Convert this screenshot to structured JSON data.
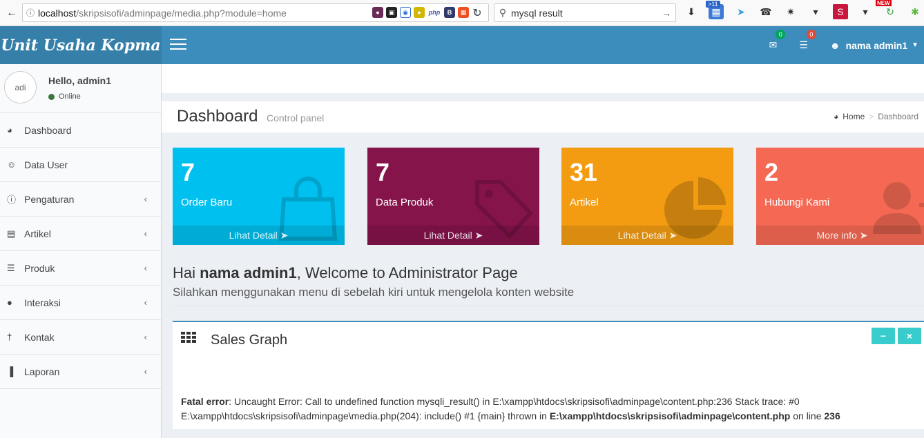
{
  "browser": {
    "back_icon": "back-arrow",
    "url_host": "localhost",
    "url_path": "/skripsisofi/adminpage/media.php?module=home",
    "search_text": "mysql result",
    "toolbar_badge": ">11",
    "new_badge": "NEW"
  },
  "header": {
    "logo": "Unit Usaha Kopma",
    "mail_count": "0",
    "notif_count": "0",
    "user_name": "nama admin1",
    "mail_badge_color": "#00a65a",
    "notif_badge_color": "#dd4b39"
  },
  "sidebar": {
    "avatar_alt": "adi",
    "hello": "Hello, admin1",
    "status": "Online",
    "items": [
      {
        "label": "Dashboard",
        "icon": "dashboard-icon",
        "glyph": "◕"
      },
      {
        "label": "Data User",
        "icon": "users-icon",
        "glyph": "☺"
      },
      {
        "label": "Pengaturan",
        "icon": "info-icon",
        "glyph": "ⓘ"
      },
      {
        "label": "Artikel",
        "icon": "book-icon",
        "glyph": "▤"
      },
      {
        "label": "Produk",
        "icon": "cart-icon",
        "glyph": "☰"
      },
      {
        "label": "Interaksi",
        "icon": "comments-icon",
        "glyph": "●"
      },
      {
        "label": "Kontak",
        "icon": "person-icon",
        "glyph": "†"
      },
      {
        "label": "Laporan",
        "icon": "bar-chart-icon",
        "glyph": "▐"
      }
    ]
  },
  "page": {
    "title": "Dashboard",
    "subtitle": "Control panel",
    "breadcrumb_home": "Home",
    "breadcrumb_current": "Dashboard"
  },
  "boxes": [
    {
      "number": "7",
      "label": "Order Baru",
      "footer": "Lihat Detail",
      "color": "#00c0ef",
      "icon": "shopping-bag-icon"
    },
    {
      "number": "7",
      "label": "Data Produk",
      "footer": "Lihat Detail",
      "color": "#85144b",
      "icon": "tag-icon"
    },
    {
      "number": "31",
      "label": "Artikel",
      "footer": "Lihat Detail",
      "color": "#f39c12",
      "icon": "pie-chart-icon"
    },
    {
      "number": "2",
      "label": "Hubungi Kami",
      "footer": "More info",
      "color": "#f56954",
      "icon": "user-plus-icon"
    }
  ],
  "welcome": {
    "prefix": "Hai ",
    "name": "nama admin1",
    "suffix": ", Welcome to Administrator Page",
    "subtitle": "Silahkan menggunakan menu di sebelah kiri untuk mengelola konten website"
  },
  "graph": {
    "title": "Sales Graph",
    "minimize_label": "−",
    "close_label": "×",
    "error_label": "Fatal error",
    "error_body": ": Uncaught Error: Call to undefined function mysqli_result() in E:\\xampp\\htdocs\\skripsisofi\\adminpage\\content.php:236 Stack trace: #0 E:\\xampp\\htdocs\\skripsisofi\\adminpage\\media.php(204): include() #1 {main} thrown in ",
    "error_file": "E:\\xampp\\htdocs\\skripsisofi\\adminpage\\content.php",
    "error_line_text": " on line ",
    "error_line": "236"
  }
}
